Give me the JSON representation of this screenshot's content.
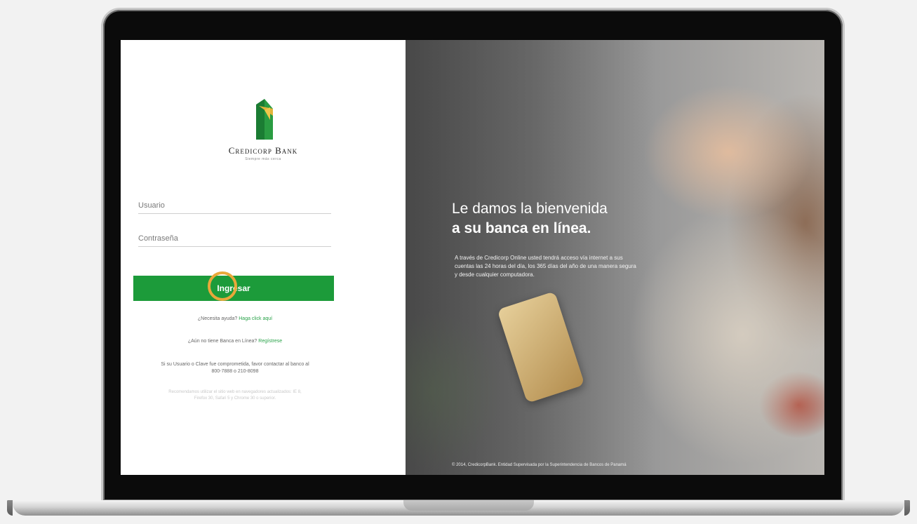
{
  "brand": {
    "name": "Credicorp Bank",
    "tagline": "Siempre más cerca"
  },
  "login": {
    "username_placeholder": "Usuario",
    "password_placeholder": "Contraseña",
    "submit_label": "Ingresar"
  },
  "help": {
    "question": "¿Necesita ayuda?",
    "link": "Haga click aquí"
  },
  "register": {
    "question": "¿Aún no tiene Banca en Línea?",
    "link": "Regístrese"
  },
  "compromise": {
    "text": "Si su Usuario o Clave fue comprometida, favor contactar al banco al",
    "phones": "800-7888 o 210-8098"
  },
  "disclaimer": {
    "line1": "Recomendamos utilizar el sitio web en navegadores actualizados: IE 8,",
    "line2": "Firefox 30, Safari 5 y Chrome 30 o superior."
  },
  "hero": {
    "title_line1": "Le damos la bienvenida",
    "title_line2": "a su banca en línea.",
    "paragraph": "A través de Credicorp Online usted tendrá acceso vía internet a sus cuentas las 24 horas del día, los 365 días del año de una manera segura y desde cualquier computadora."
  },
  "footer": {
    "copyright": "© 2014, CredicorpBank. Entidad Supervisada por la Superintendencia de Bancos de Panamá"
  },
  "colors": {
    "primary_green": "#1c9b3a",
    "link_green": "#2aa34a",
    "highlight_ring": "#e8a83a",
    "logo_gold": "#e2b43a"
  }
}
